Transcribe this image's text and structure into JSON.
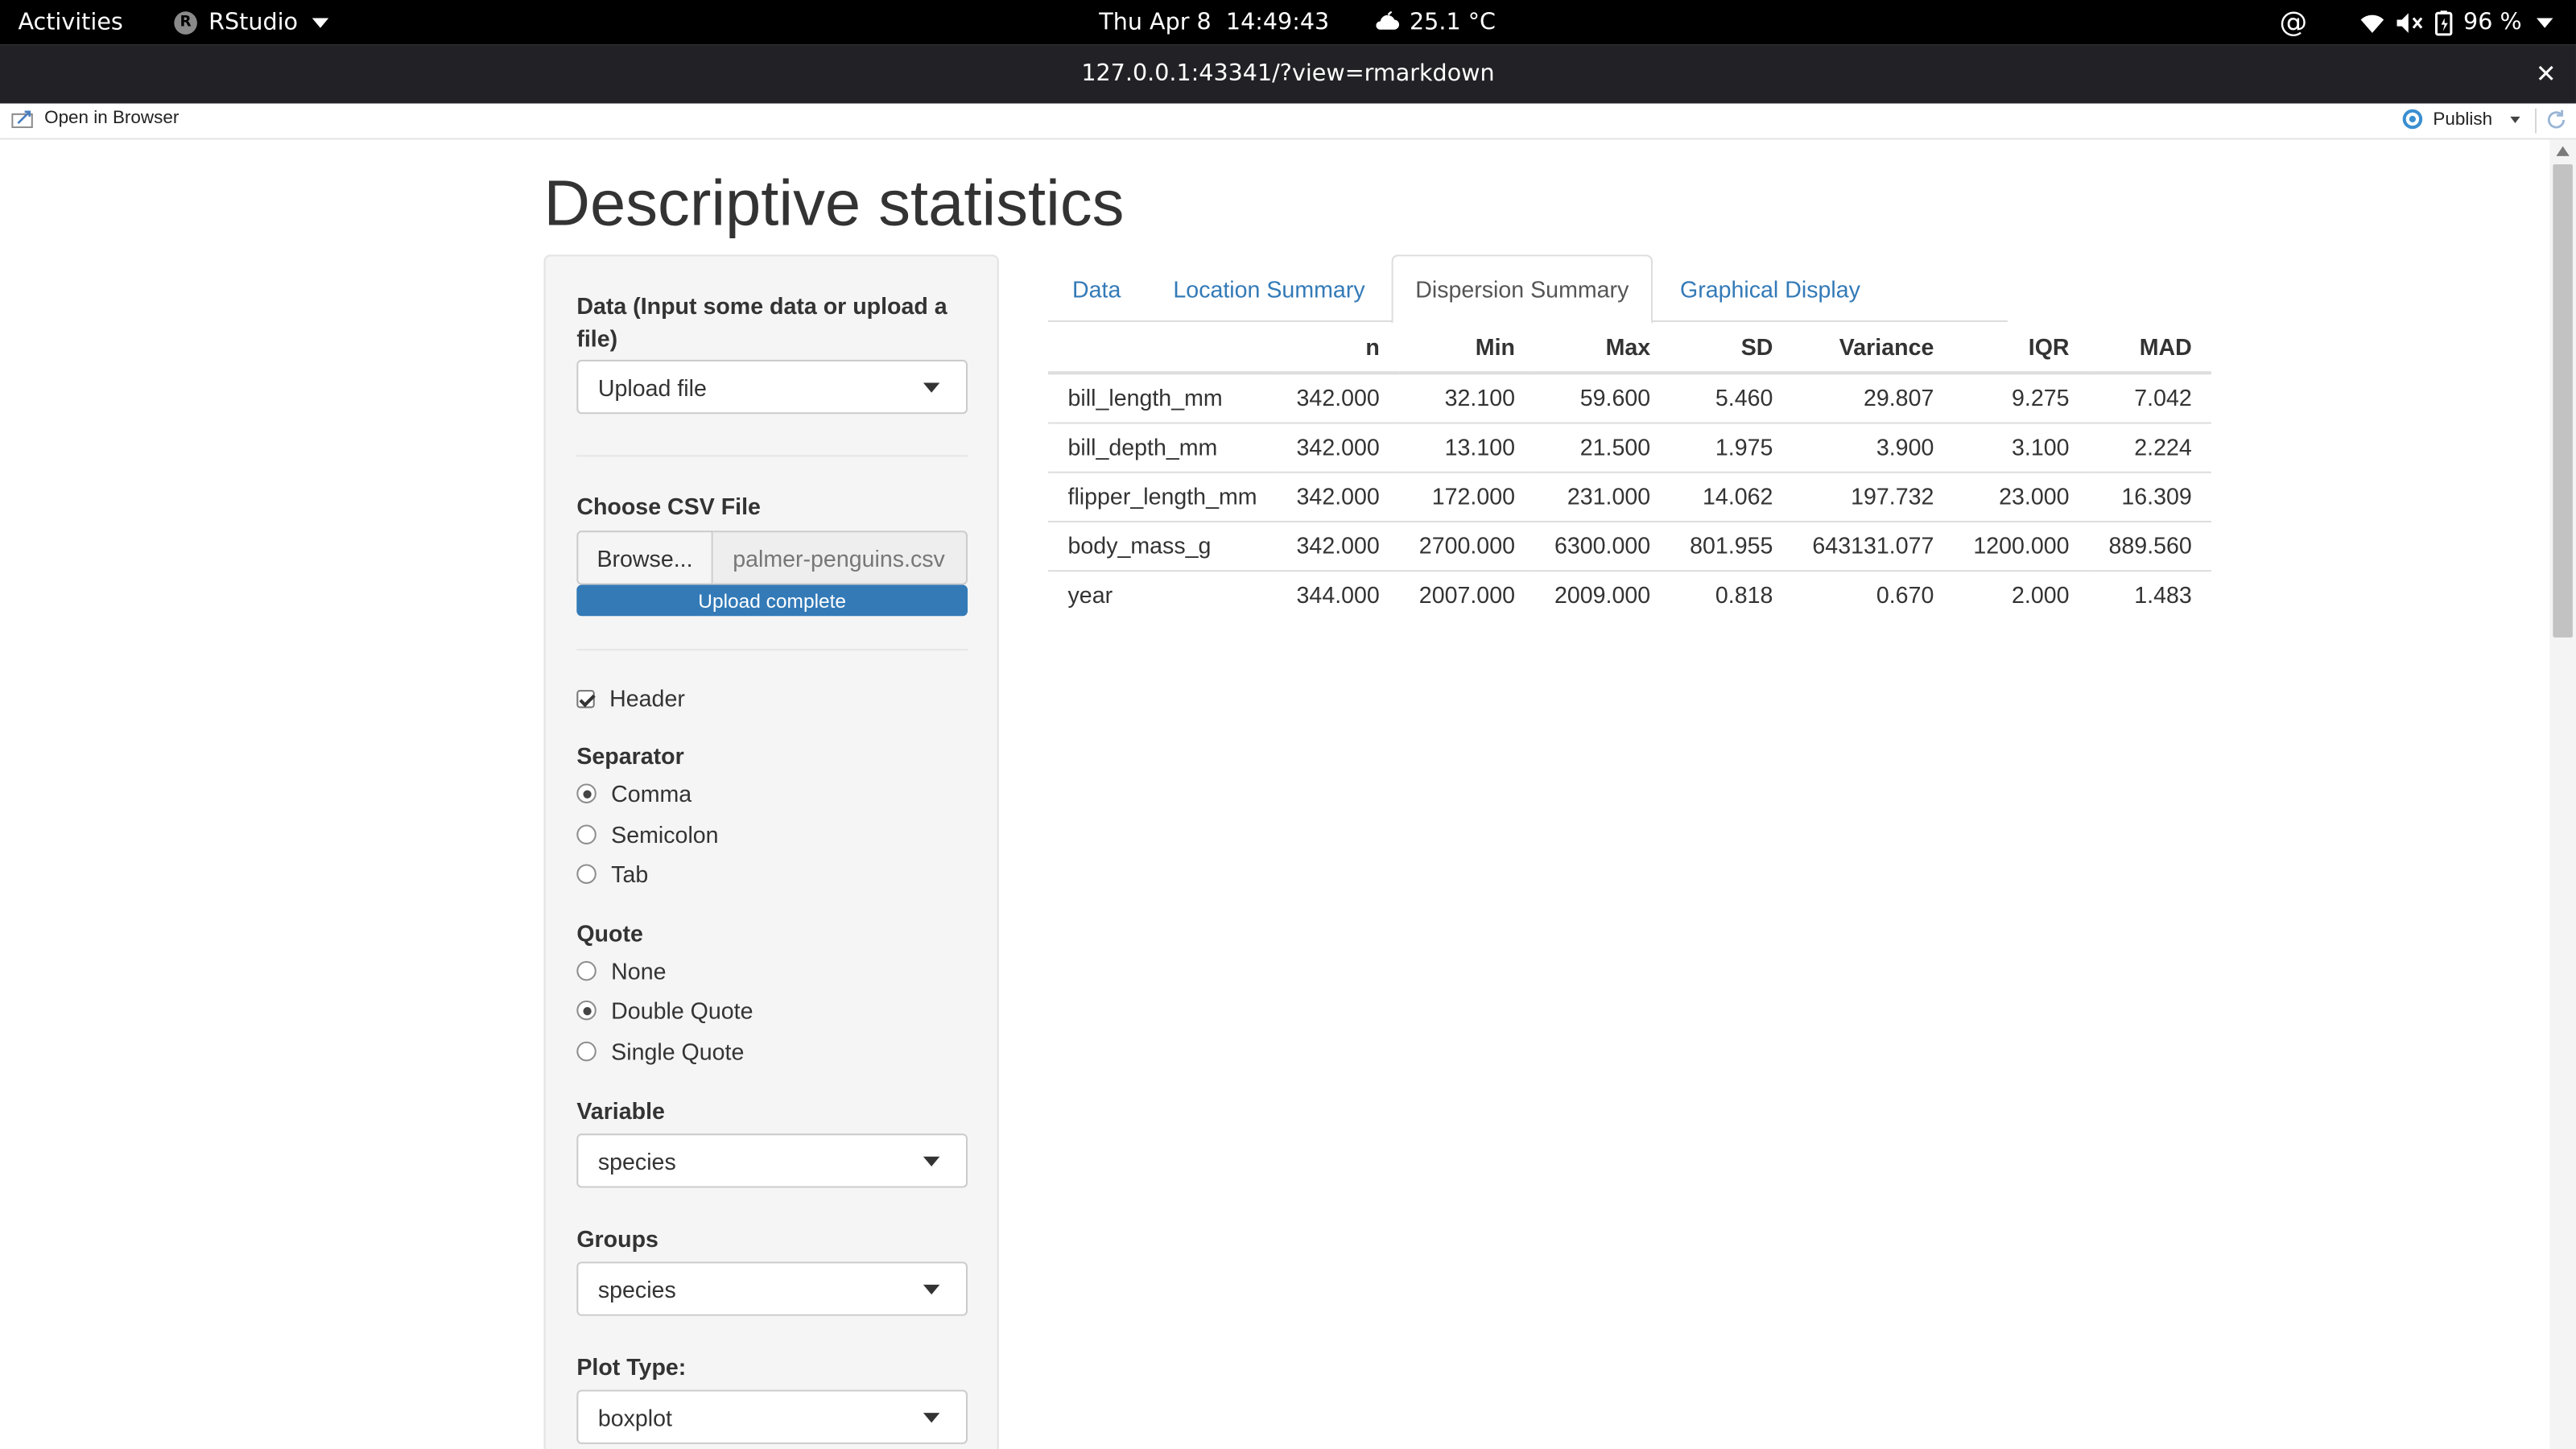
{
  "system_bar": {
    "activities": "Activities",
    "app_name": "RStudio",
    "app_badge": "R",
    "clock": "Thu Apr 8  14:49:43",
    "weather": "25.1 °C",
    "battery": "96 %",
    "icons": [
      "weather-cloud-icon",
      "at-sign-icon",
      "wifi-icon",
      "volume-muted-icon",
      "battery-charging-icon",
      "system-menu-chevron-icon"
    ]
  },
  "window": {
    "title": "127.0.0.1:43341/?view=rmarkdown",
    "close": "✕"
  },
  "viewer_toolbar": {
    "open_in_browser": "Open in Browser",
    "publish": "Publish"
  },
  "page": {
    "title": "Descriptive statistics"
  },
  "sidebar": {
    "data_label": "Data (Input some data or upload a file)",
    "data_source": "Upload file",
    "csv_label": "Choose CSV File",
    "browse": "Browse...",
    "file_name": "palmer-penguins.csv",
    "upload_status": "Upload complete",
    "upload_progress_percent": 100,
    "header_label": "Header",
    "header_checked": true,
    "separator_label": "Separator",
    "separator_options": [
      "Comma",
      "Semicolon",
      "Tab"
    ],
    "separator_selected": "Comma",
    "quote_label": "Quote",
    "quote_options": [
      "None",
      "Double Quote",
      "Single Quote"
    ],
    "quote_selected": "Double Quote",
    "variable_label": "Variable",
    "variable_value": "species",
    "groups_label": "Groups",
    "groups_value": "species",
    "plot_type_label": "Plot Type:",
    "plot_type_value": "boxplot"
  },
  "tabs": [
    {
      "label": "Data",
      "active": false
    },
    {
      "label": "Location Summary",
      "active": false
    },
    {
      "label": "Dispersion Summary",
      "active": true
    },
    {
      "label": "Graphical Display",
      "active": false
    }
  ],
  "table": {
    "columns": [
      "",
      "n",
      "Min",
      "Max",
      "SD",
      "Variance",
      "IQR",
      "MAD"
    ],
    "rows": [
      [
        "bill_length_mm",
        "342.000",
        "32.100",
        "59.600",
        "5.460",
        "29.807",
        "9.275",
        "7.042"
      ],
      [
        "bill_depth_mm",
        "342.000",
        "13.100",
        "21.500",
        "1.975",
        "3.900",
        "3.100",
        "2.224"
      ],
      [
        "flipper_length_mm",
        "342.000",
        "172.000",
        "231.000",
        "14.062",
        "197.732",
        "23.000",
        "16.309"
      ],
      [
        "body_mass_g",
        "342.000",
        "2700.000",
        "6300.000",
        "801.955",
        "643131.077",
        "1200.000",
        "889.560"
      ],
      [
        "year",
        "344.000",
        "2007.000",
        "2009.000",
        "0.818",
        "0.670",
        "2.000",
        "1.483"
      ]
    ]
  },
  "colors": {
    "link": "#337ab7",
    "progress": "#337ab7",
    "topbar": "#000000",
    "titlebar": "#222226"
  }
}
